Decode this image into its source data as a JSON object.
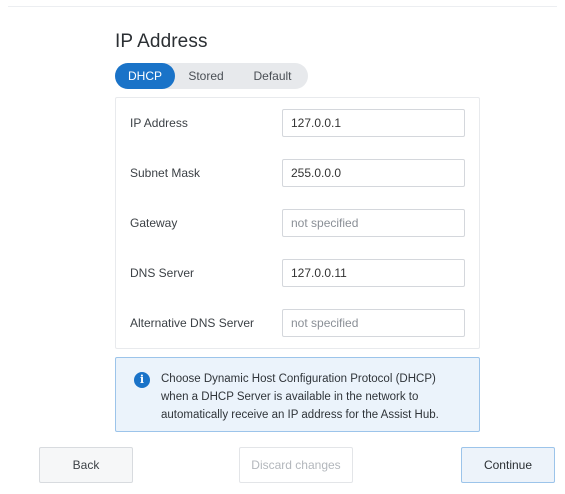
{
  "section": {
    "title": "IP Address"
  },
  "mode_tabs": {
    "items": [
      "DHCP",
      "Stored",
      "Default"
    ],
    "selected": "DHCP"
  },
  "fields": [
    {
      "label": "IP Address",
      "value": "127.0.0.1",
      "placeholder": ""
    },
    {
      "label": "Subnet Mask",
      "value": "255.0.0.0",
      "placeholder": ""
    },
    {
      "label": "Gateway",
      "value": "",
      "placeholder": "not specified"
    },
    {
      "label": "DNS Server",
      "value": "127.0.0.11",
      "placeholder": ""
    },
    {
      "label": "Alternative DNS Server",
      "value": "",
      "placeholder": "not specified"
    }
  ],
  "info": {
    "icon": "info-icon",
    "lines": [
      "Choose Dynamic Host Configuration Protocol (DHCP)",
      "when a DHCP Server is available in the network to",
      "automatically receive an IP address for the Assist Hub."
    ]
  },
  "actions": {
    "back_label": "Back",
    "discard_label": "Discard changes",
    "continue_label": "Continue"
  },
  "colors": {
    "accent": "#1a73c8",
    "info_background": "#ebf3fb",
    "info_border": "#9cc4ea"
  }
}
